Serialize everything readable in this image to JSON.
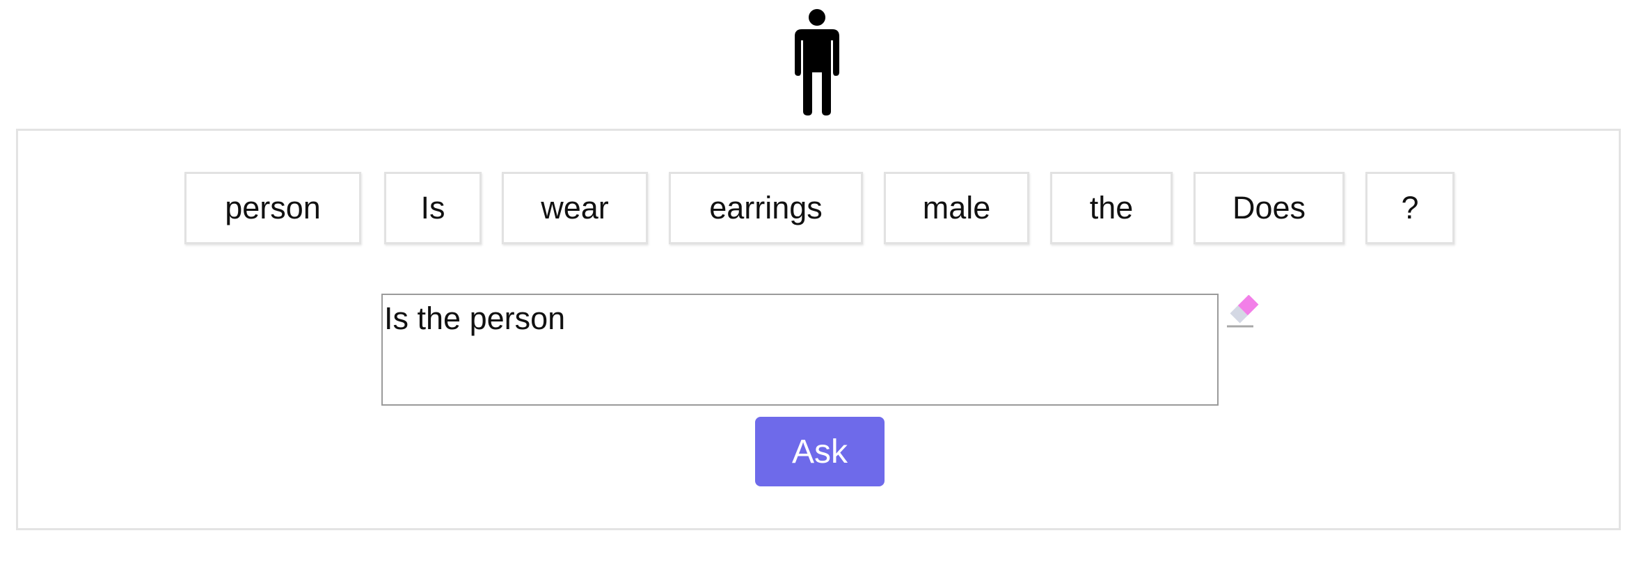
{
  "word_bank": [
    {
      "label": "person"
    },
    {
      "label": "Is"
    },
    {
      "label": "wear"
    },
    {
      "label": "earrings"
    },
    {
      "label": "male"
    },
    {
      "label": "the"
    },
    {
      "label": "Does"
    },
    {
      "label": "?"
    }
  ],
  "question": {
    "value": "Is the person"
  },
  "ask_button": {
    "label": "Ask"
  },
  "icons": {
    "figure": "person-icon",
    "eraser": "eraser-icon"
  },
  "colors": {
    "ask_button_bg": "#6e6aea",
    "eraser_pink": "#f27fe8"
  }
}
